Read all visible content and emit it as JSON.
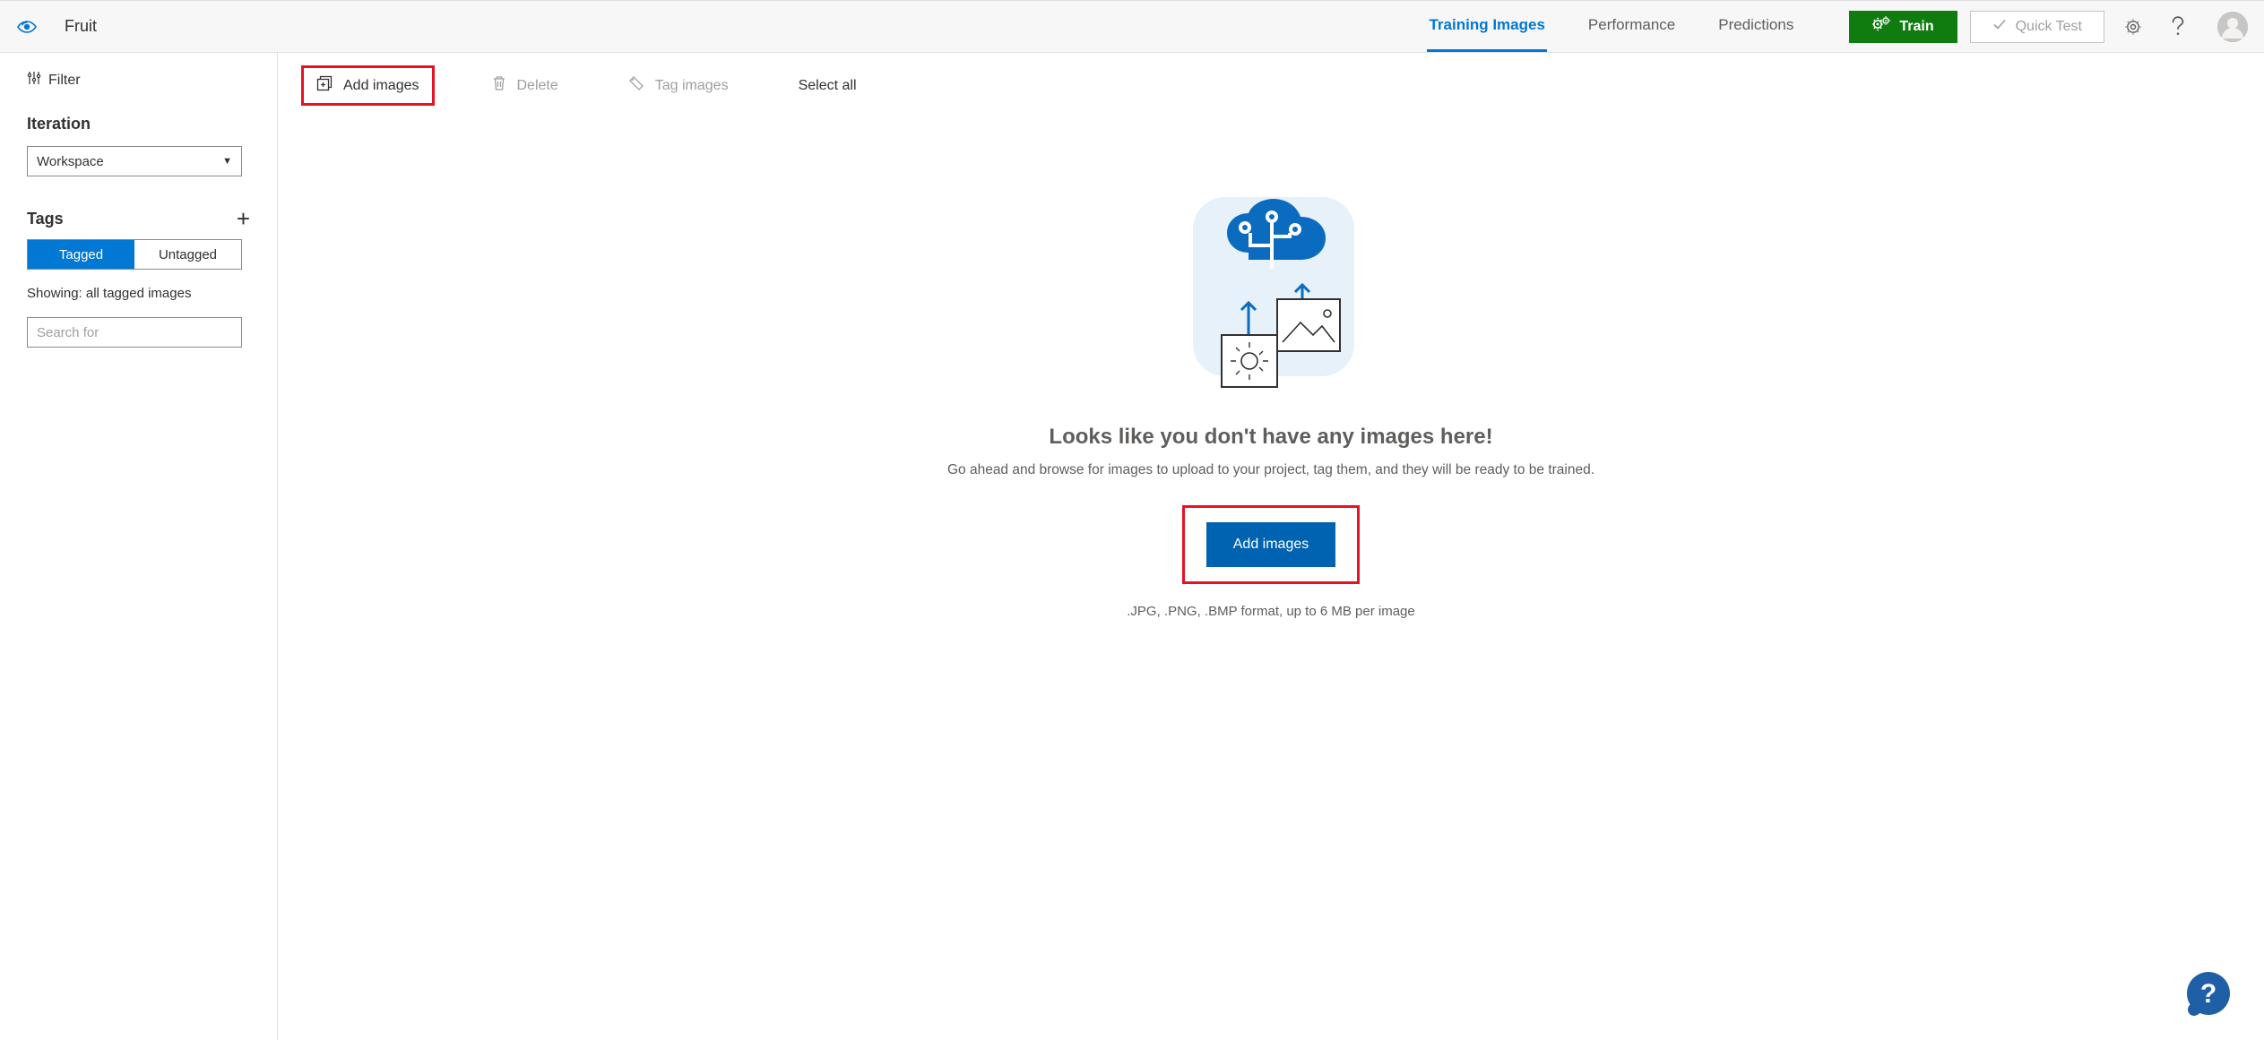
{
  "header": {
    "project_name": "Fruit",
    "tabs": {
      "training_images": "Training Images",
      "performance": "Performance",
      "predictions": "Predictions"
    },
    "train_label": "Train",
    "quick_test_label": "Quick Test"
  },
  "sidebar": {
    "filter_label": "Filter",
    "iteration_label": "Iteration",
    "iteration_selected": "Workspace",
    "tags_label": "Tags",
    "tagged_label": "Tagged",
    "untagged_label": "Untagged",
    "showing_text": "Showing: all tagged images",
    "search_placeholder": "Search for"
  },
  "toolbar": {
    "add_images": "Add images",
    "delete": "Delete",
    "tag_images": "Tag images",
    "select_all": "Select all"
  },
  "empty_state": {
    "title": "Looks like you don't have any images here!",
    "subtitle": "Go ahead and browse for images to upload to your project, tag them, and they will be ready to be trained.",
    "add_button": "Add images",
    "formats": ".JPG, .PNG, .BMP format, up to 6 MB per image"
  }
}
